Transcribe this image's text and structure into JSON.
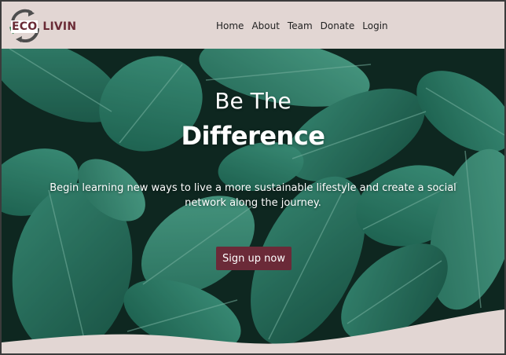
{
  "brand": {
    "logo_part1": "ECO",
    "logo_part2": "LIVIN",
    "accent_color": "#6b2a38",
    "nav_bg_color": "#e2d6d3"
  },
  "nav": {
    "items": [
      {
        "label": "Home"
      },
      {
        "label": "About"
      },
      {
        "label": "Team"
      },
      {
        "label": "Donate"
      },
      {
        "label": "Login"
      }
    ]
  },
  "hero": {
    "title_line1": "Be The",
    "title_line2": "Difference",
    "tagline": "Begin learning new ways to live a more sustainable lifestyle and create a social network along the journey.",
    "cta_label": "Sign up now",
    "background": "tropical-leaves-image"
  }
}
